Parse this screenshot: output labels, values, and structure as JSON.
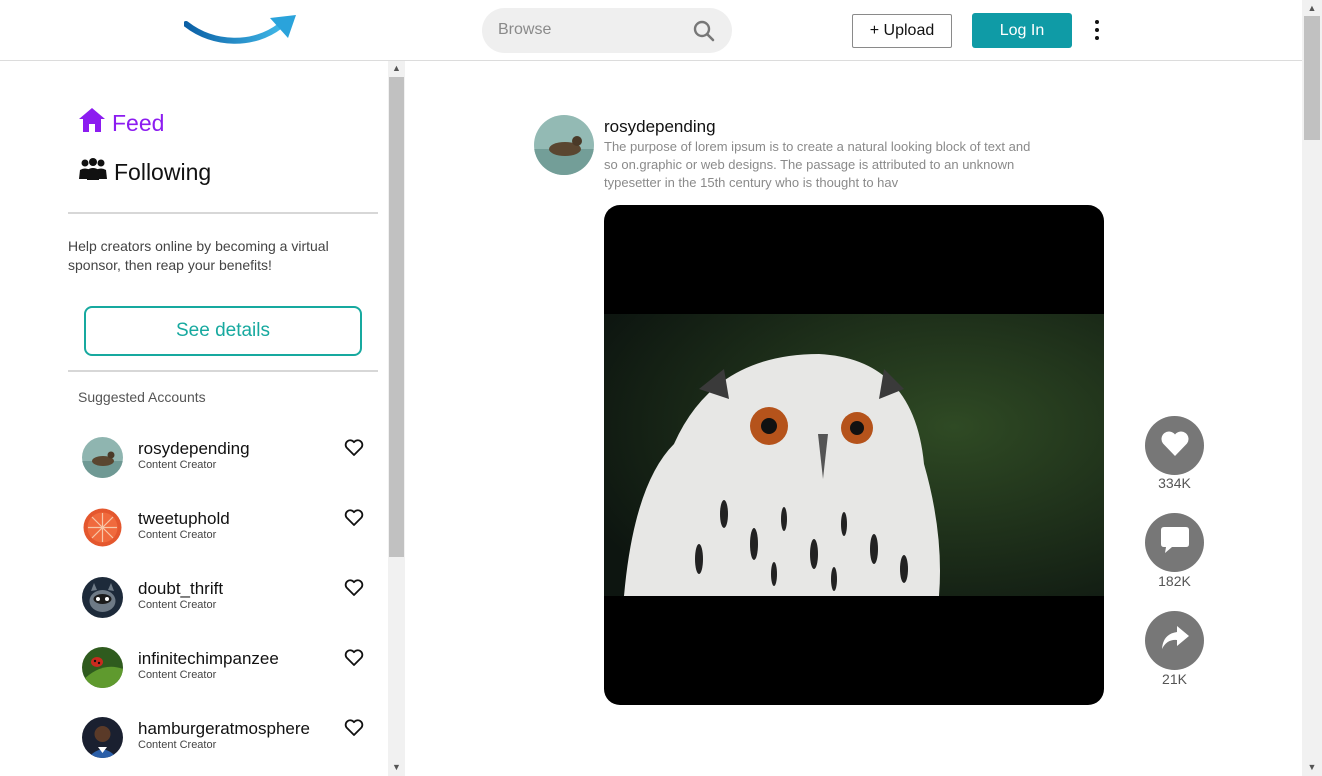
{
  "header": {
    "search_placeholder": "Browse",
    "upload_label": "+ Upload",
    "login_label": "Log In"
  },
  "sidebar": {
    "nav": [
      {
        "label": "Feed",
        "icon": "home-icon",
        "active": true
      },
      {
        "label": "Following",
        "icon": "people-icon",
        "active": false
      }
    ],
    "promo_text": "Help creators online by becoming a virtual sponsor, then reap your benefits!",
    "details_label": "See details",
    "suggested_title": "Suggested Accounts",
    "accounts": [
      {
        "name": "rosydepending",
        "role": "Content Creator"
      },
      {
        "name": "tweetuphold",
        "role": "Content Creator"
      },
      {
        "name": "doubt_thrift",
        "role": "Content Creator"
      },
      {
        "name": "infinitechimpanzee",
        "role": "Content Creator"
      },
      {
        "name": "hamburgeratmosphere",
        "role": "Content Creator"
      }
    ]
  },
  "post": {
    "username": "rosydepending",
    "description": "The purpose of lorem ipsum is to create a natural looking block of text and so on.graphic or web designs. The passage is attributed to an unknown typesetter in the 15th century who is thought to hav",
    "likes": "334K",
    "comments": "182K",
    "shares": "21K"
  },
  "colors": {
    "accent_purple": "#8c1cf0",
    "teal": "#0f9ba6",
    "outline_teal": "#17a99f",
    "action_gray": "#777777"
  }
}
